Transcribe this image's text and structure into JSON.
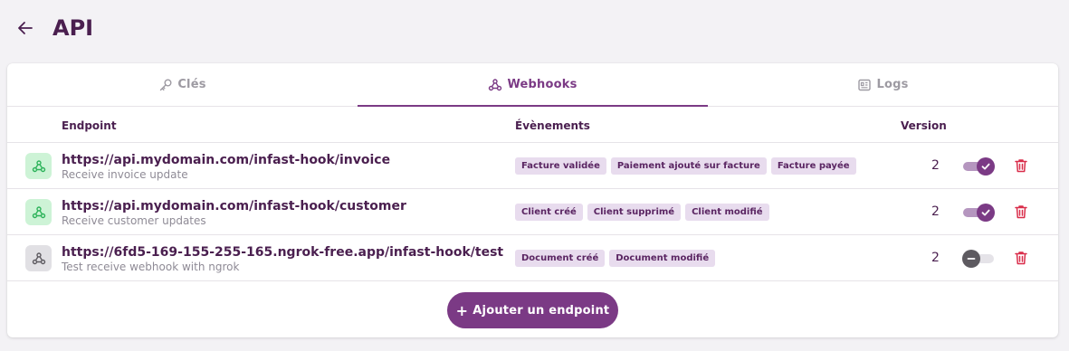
{
  "header": {
    "title": "API"
  },
  "tabs": [
    {
      "label": "Clés",
      "icon": "key-icon",
      "active": false
    },
    {
      "label": "Webhooks",
      "icon": "webhook-icon",
      "active": true
    },
    {
      "label": "Logs",
      "icon": "logs-icon",
      "active": false
    }
  ],
  "table": {
    "columns": {
      "endpoint": "Endpoint",
      "events": "Évènements",
      "version": "Version"
    },
    "rows": [
      {
        "url": "https://api.mydomain.com/infast-hook/invoice",
        "description": "Receive invoice update",
        "events": [
          "Facture validée",
          "Paiement ajouté sur facture",
          "Facture payée"
        ],
        "version": "2",
        "enabled": true,
        "icon_color": "green"
      },
      {
        "url": "https://api.mydomain.com/infast-hook/customer",
        "description": "Receive customer updates",
        "events": [
          "Client créé",
          "Client supprimé",
          "Client modifié"
        ],
        "version": "2",
        "enabled": true,
        "icon_color": "green"
      },
      {
        "url": "https://6fd5-169-155-255-165.ngrok-free.app/infast-hook/test",
        "description": "Test receive webhook with ngrok",
        "events": [
          "Document créé",
          "Document modifié"
        ],
        "version": "2",
        "enabled": false,
        "icon_color": "grey"
      }
    ]
  },
  "add_button": {
    "label": "Ajouter un endpoint"
  },
  "colors": {
    "primary": "#7b3a85",
    "danger": "#d92d4a",
    "success_icon": "#2db35a",
    "text": "#4a1f4f"
  }
}
